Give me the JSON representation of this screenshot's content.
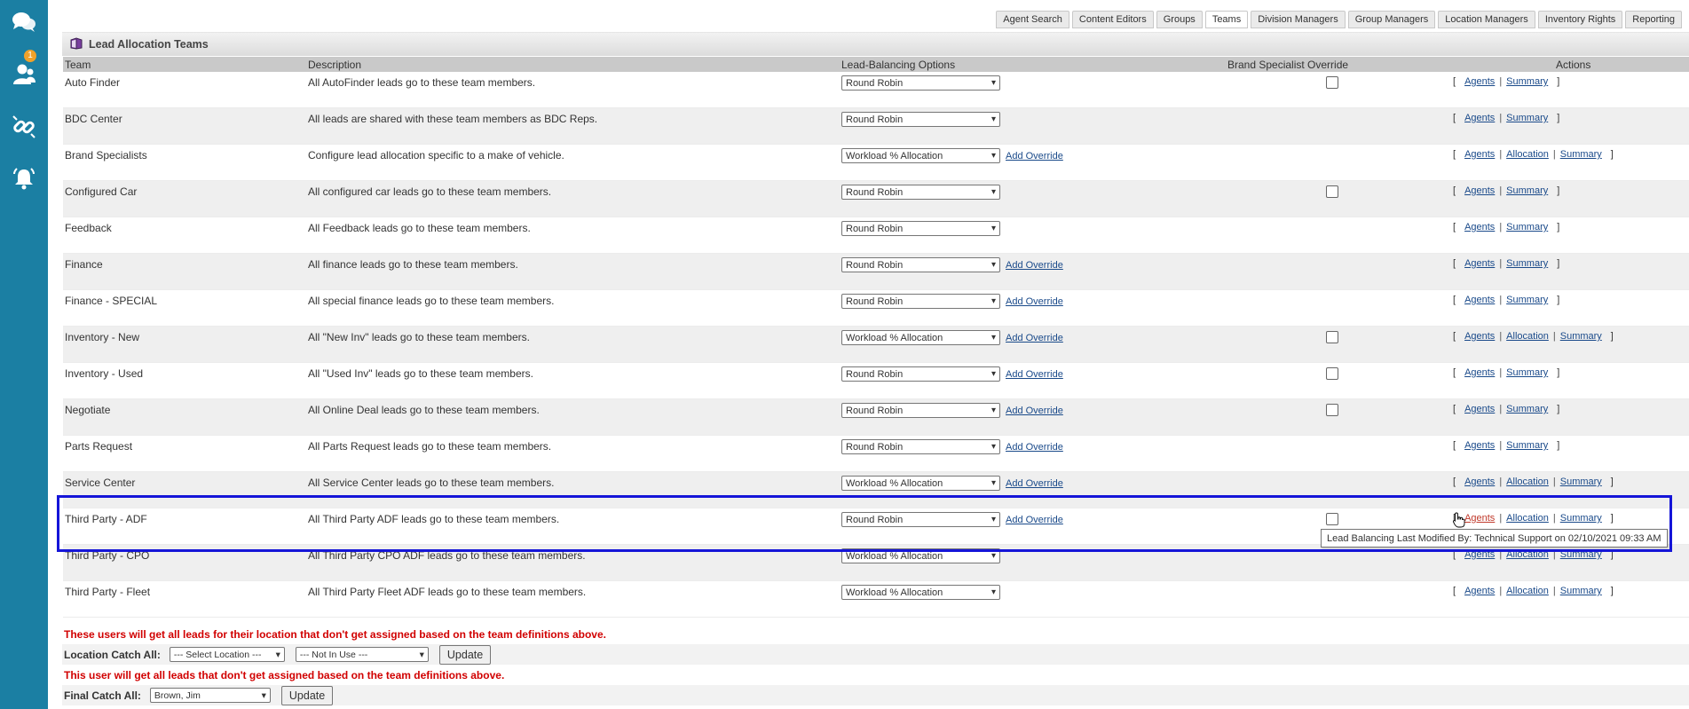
{
  "sidebar": {
    "badge_count": "1",
    "icons": [
      "chat-icon",
      "users-icon",
      "link-icon",
      "bell-icon"
    ]
  },
  "tabs": [
    "Agent Search",
    "Content Editors",
    "Groups",
    "Teams",
    "Division Managers",
    "Group Managers",
    "Location Managers",
    "Inventory Rights",
    "Reporting"
  ],
  "active_tab": "Teams",
  "panel": {
    "title": "Lead Allocation Teams"
  },
  "columns": {
    "team": "Team",
    "description": "Description",
    "options": "Lead-Balancing Options",
    "brand_override": "Brand Specialist Override",
    "actions": "Actions"
  },
  "labels": {
    "add_override": "Add Override",
    "agents": "Agents",
    "allocation": "Allocation",
    "summary": "Summary",
    "bracket_open": "[",
    "bracket_close": "]",
    "sep": "|"
  },
  "rows": [
    {
      "team": "Auto Finder",
      "desc": "All AutoFinder leads go to these team members.",
      "option": "Round Robin",
      "override": false,
      "checkbox": true,
      "allocation": false
    },
    {
      "team": "BDC Center",
      "desc": "All leads are shared with these team members as BDC Reps.",
      "option": "Round Robin",
      "override": false,
      "checkbox": false,
      "allocation": false
    },
    {
      "team": "Brand Specialists",
      "desc": "Configure lead allocation specific to a make of vehicle.",
      "option": "Workload % Allocation",
      "override": true,
      "checkbox": false,
      "allocation": true
    },
    {
      "team": "Configured Car",
      "desc": "All configured car leads go to these team members.",
      "option": "Round Robin",
      "override": false,
      "checkbox": true,
      "allocation": false
    },
    {
      "team": "Feedback",
      "desc": "All Feedback leads go to these team members.",
      "option": "Round Robin",
      "override": false,
      "checkbox": false,
      "allocation": false
    },
    {
      "team": "Finance",
      "desc": "All finance leads go to these team members.",
      "option": "Round Robin",
      "override": true,
      "checkbox": false,
      "allocation": false
    },
    {
      "team": "Finance - SPECIAL",
      "desc": "All special finance leads go to these team members.",
      "option": "Round Robin",
      "override": true,
      "checkbox": false,
      "allocation": false
    },
    {
      "team": "Inventory - New",
      "desc": "All \"New Inv\" leads go to these team members.",
      "option": "Workload % Allocation",
      "override": true,
      "checkbox": true,
      "allocation": true
    },
    {
      "team": "Inventory - Used",
      "desc": "All \"Used Inv\" leads go to these team members.",
      "option": "Round Robin",
      "override": true,
      "checkbox": true,
      "allocation": false
    },
    {
      "team": "Negotiate",
      "desc": "All Online Deal leads go to these team members.",
      "option": "Round Robin",
      "override": true,
      "checkbox": true,
      "allocation": false
    },
    {
      "team": "Parts Request",
      "desc": "All Parts Request leads go to these team members.",
      "option": "Round Robin",
      "override": true,
      "checkbox": false,
      "allocation": false
    },
    {
      "team": "Service Center",
      "desc": "All Service Center leads go to these team members.",
      "option": "Workload % Allocation",
      "override": true,
      "checkbox": false,
      "allocation": true
    },
    {
      "team": "Third Party - ADF",
      "desc": "All Third Party ADF leads go to these team members.",
      "option": "Round Robin",
      "override": true,
      "checkbox": true,
      "allocation": true
    },
    {
      "team": "Third Party - CPO",
      "desc": "All Third Party CPO ADF leads go to these team members.",
      "option": "Workload % Allocation",
      "override": false,
      "checkbox": false,
      "allocation": true
    },
    {
      "team": "Third Party - Fleet",
      "desc": "All Third Party Fleet ADF leads go to these team members.",
      "option": "Workload % Allocation",
      "override": false,
      "checkbox": false,
      "allocation": true
    }
  ],
  "tooltip": "Lead Balancing Last Modified By: Technical Support on 02/10/2021 09:33 AM",
  "footer": {
    "location_warning": "These users will get all leads for their location that don't get assigned based on the team definitions above.",
    "location_label": "Location Catch All:",
    "location_select": "--- Select Location ---",
    "location_use_select": "--- Not In Use ---",
    "update_label": "Update",
    "final_warning": "This user will get all leads that don't get assigned based on the team definitions above.",
    "final_label": "Final Catch All:",
    "final_select": "Brown, Jim"
  }
}
